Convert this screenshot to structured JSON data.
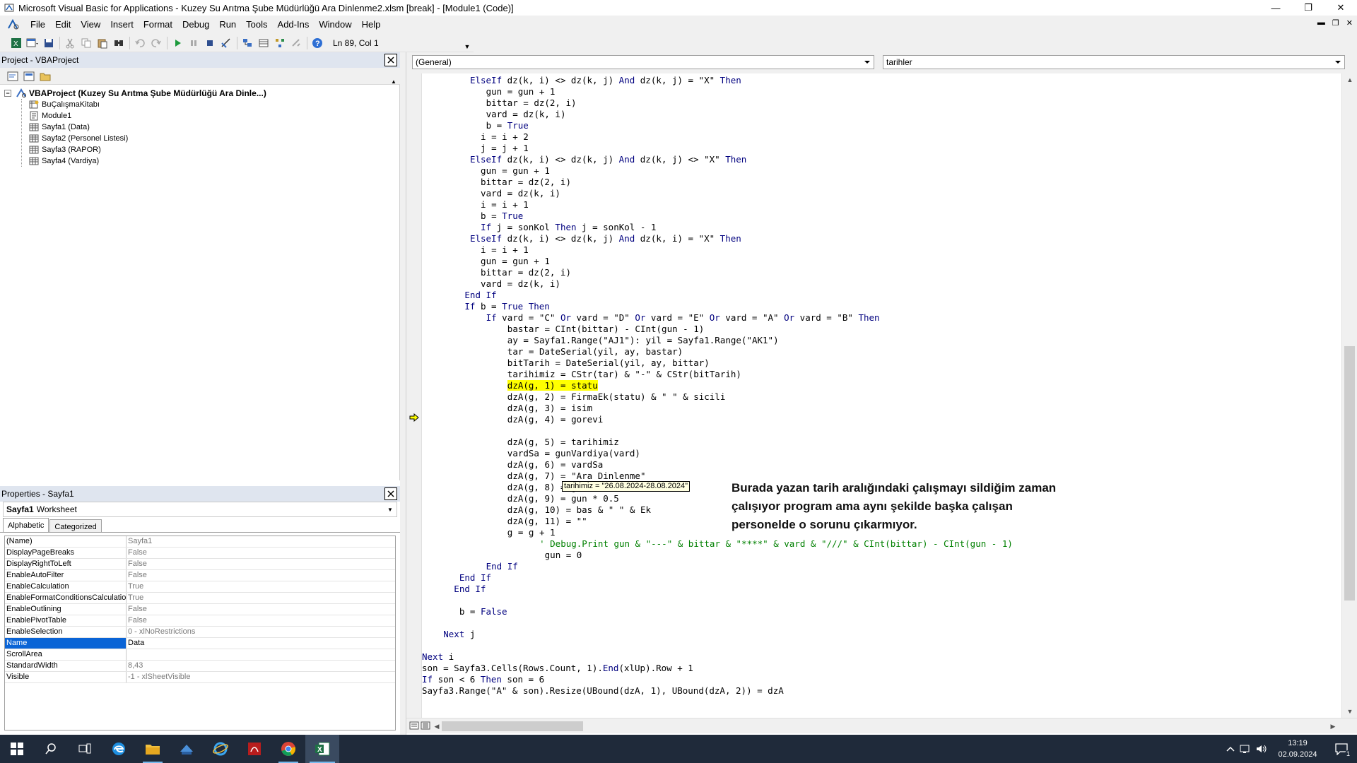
{
  "window": {
    "title": "Microsoft Visual Basic for Applications - Kuzey Su Arıtma Şube Müdürlüğü Ara Dinlenme2.xlsm [break] - [Module1 (Code)]"
  },
  "menu": [
    "File",
    "Edit",
    "View",
    "Insert",
    "Format",
    "Debug",
    "Run",
    "Tools",
    "Add-Ins",
    "Window",
    "Help"
  ],
  "toolbar": {
    "position": "Ln 89, Col 1"
  },
  "project": {
    "title": "Project - VBAProject",
    "root": "VBAProject (Kuzey Su Arıtma Şube Müdürlüğü Ara Dinle...)",
    "items": [
      "BuÇalışmaKitabı",
      "Module1",
      "Sayfa1 (Data)",
      "Sayfa2 (Personel Listesi)",
      "Sayfa3 (RAPOR)",
      "Sayfa4 (Vardiya)"
    ]
  },
  "properties": {
    "title": "Properties - Sayfa1",
    "object_name": "Sayfa1",
    "object_type": "Worksheet",
    "tabs": [
      "Alphabetic",
      "Categorized"
    ],
    "rows": [
      {
        "name": "(Name)",
        "value": "Sayfa1"
      },
      {
        "name": "DisplayPageBreaks",
        "value": "False"
      },
      {
        "name": "DisplayRightToLeft",
        "value": "False"
      },
      {
        "name": "EnableAutoFilter",
        "value": "False"
      },
      {
        "name": "EnableCalculation",
        "value": "True"
      },
      {
        "name": "EnableFormatConditionsCalculation",
        "value": "True"
      },
      {
        "name": "EnableOutlining",
        "value": "False"
      },
      {
        "name": "EnablePivotTable",
        "value": "False"
      },
      {
        "name": "EnableSelection",
        "value": "0 - xlNoRestrictions"
      },
      {
        "name": "Name",
        "value": "Data"
      },
      {
        "name": "ScrollArea",
        "value": ""
      },
      {
        "name": "StandardWidth",
        "value": "8,43"
      },
      {
        "name": "Visible",
        "value": "-1 - xlSheetVisible"
      }
    ],
    "selected_row": "Name"
  },
  "code": {
    "object_combo": "(General)",
    "proc_combo": "tarihler",
    "lines": [
      {
        "indent": 9,
        "text": "ElseIf dz(k, i) <> dz(k, j) And dz(k, j) = \"X\" Then",
        "kind": "code"
      },
      {
        "indent": 12,
        "text": "gun = gun + 1",
        "kind": "code"
      },
      {
        "indent": 12,
        "text": "bittar = dz(2, i)",
        "kind": "code"
      },
      {
        "indent": 12,
        "text": "vard = dz(k, i)",
        "kind": "code"
      },
      {
        "indent": 12,
        "text": "b = True",
        "kind": "code"
      },
      {
        "indent": 11,
        "text": "i = i + 2",
        "kind": "code"
      },
      {
        "indent": 11,
        "text": "j = j + 1",
        "kind": "code"
      },
      {
        "indent": 9,
        "text": "ElseIf dz(k, i) <> dz(k, j) And dz(k, j) <> \"X\" Then",
        "kind": "code"
      },
      {
        "indent": 11,
        "text": "gun = gun + 1",
        "kind": "code"
      },
      {
        "indent": 11,
        "text": "bittar = dz(2, i)",
        "kind": "code"
      },
      {
        "indent": 11,
        "text": "vard = dz(k, i)",
        "kind": "code"
      },
      {
        "indent": 11,
        "text": "i = i + 1",
        "kind": "code"
      },
      {
        "indent": 11,
        "text": "b = True",
        "kind": "code"
      },
      {
        "indent": 11,
        "text": "If j = sonKol Then j = sonKol - 1",
        "kind": "code"
      },
      {
        "indent": 9,
        "text": "ElseIf dz(k, i) <> dz(k, j) And dz(k, i) = \"X\" Then",
        "kind": "code"
      },
      {
        "indent": 11,
        "text": "i = i + 1",
        "kind": "code"
      },
      {
        "indent": 11,
        "text": "gun = gun + 1",
        "kind": "code"
      },
      {
        "indent": 11,
        "text": "bittar = dz(2, i)",
        "kind": "code"
      },
      {
        "indent": 11,
        "text": "vard = dz(k, i)",
        "kind": "code"
      },
      {
        "indent": 8,
        "text": "End If",
        "kind": "code"
      },
      {
        "indent": 8,
        "text": "If b = True Then",
        "kind": "code"
      },
      {
        "indent": 12,
        "text": "If vard = \"C\" Or vard = \"D\" Or vard = \"E\" Or vard = \"A\" Or vard = \"B\" Then",
        "kind": "code"
      },
      {
        "indent": 16,
        "text": "bastar = CInt(bittar) - CInt(gun - 1)",
        "kind": "code"
      },
      {
        "indent": 16,
        "text": "ay = Sayfa1.Range(\"AJ1\"): yil = Sayfa1.Range(\"AK1\")",
        "kind": "code"
      },
      {
        "indent": 16,
        "text": "tar = DateSerial(yil, ay, bastar)",
        "kind": "code"
      },
      {
        "indent": 16,
        "text": "bitTarih = DateSerial(yil, ay, bittar)",
        "kind": "code"
      },
      {
        "indent": 16,
        "text": "tarihimiz = CStr(tar) & \"-\" & CStr(bitTarih)",
        "kind": "code"
      },
      {
        "indent": 16,
        "text": "dzA(g, 1) = statu",
        "kind": "highlight"
      },
      {
        "indent": 16,
        "text": "dzA(g, 2) = FirmaEk(statu) & \" \" & sicili",
        "kind": "code"
      },
      {
        "indent": 16,
        "text": "dzA(g, 3) = isim",
        "kind": "code"
      },
      {
        "indent": 16,
        "text": "dzA(g, 4) = gorevi",
        "kind": "code"
      },
      {
        "indent": 0,
        "text": "",
        "kind": "code"
      },
      {
        "indent": 16,
        "text": "dzA(g, 5) = tarihimiz",
        "kind": "code"
      },
      {
        "indent": 16,
        "text": "vardSa = gunVardiya(vard)",
        "kind": "code"
      },
      {
        "indent": 16,
        "text": "dzA(g, 6) = vardSa",
        "kind": "code"
      },
      {
        "indent": 16,
        "text": "dzA(g, 7) = \"Ara Dinlenme\"",
        "kind": "code"
      },
      {
        "indent": 16,
        "text": "dzA(g, 8) = gun",
        "kind": "code"
      },
      {
        "indent": 16,
        "text": "dzA(g, 9) = gun * 0.5",
        "kind": "code"
      },
      {
        "indent": 16,
        "text": "dzA(g, 10) = bas & \" \" & Ek",
        "kind": "code"
      },
      {
        "indent": 16,
        "text": "dzA(g, 11) = \"\"",
        "kind": "code"
      },
      {
        "indent": 16,
        "text": "g = g + 1",
        "kind": "code"
      },
      {
        "indent": 22,
        "text": "' Debug.Print gun & \"---\" & bittar & \"****\" & vard & \"///\" & CInt(bittar) - CInt(gun - 1)",
        "kind": "comment"
      },
      {
        "indent": 23,
        "text": "gun = 0",
        "kind": "code"
      },
      {
        "indent": 12,
        "text": "End If",
        "kind": "code"
      },
      {
        "indent": 7,
        "text": "End If",
        "kind": "code"
      },
      {
        "indent": 6,
        "text": "End If",
        "kind": "code"
      },
      {
        "indent": 0,
        "text": "",
        "kind": "code"
      },
      {
        "indent": 7,
        "text": "b = False",
        "kind": "code"
      },
      {
        "indent": 0,
        "text": "",
        "kind": "code"
      },
      {
        "indent": 4,
        "text": "Next j",
        "kind": "code"
      },
      {
        "indent": 0,
        "text": "",
        "kind": "code"
      },
      {
        "indent": 0,
        "text": "Next i",
        "kind": "code"
      },
      {
        "indent": 0,
        "text": "son = Sayfa3.Cells(Rows.Count, 1).End(xlUp).Row + 1",
        "kind": "code"
      },
      {
        "indent": 0,
        "text": "If son < 6 Then son = 6",
        "kind": "code"
      },
      {
        "indent": 0,
        "text": "Sayfa3.Range(\"A\" & son).Resize(UBound(dzA, 1), UBound(dzA, 2)) = dzA",
        "kind": "code"
      }
    ],
    "tooltip": "tarihimiz = \"26.08.2024-28.08.2024\"",
    "annotation": [
      "Burada yazan tarih aralığındaki çalışmayı sildiğim zaman",
      "çalışıyor program ama aynı şekilde başka çalışan",
      "personelde o sorunu çıkarmıyor."
    ]
  },
  "taskbar": {
    "time": "13:19",
    "date": "02.09.2024",
    "notification_count": "1"
  },
  "colors": {
    "keyword": "#00007f",
    "comment": "#008000",
    "highlight": "#ffff00",
    "taskbar": "#1f2a3a"
  }
}
